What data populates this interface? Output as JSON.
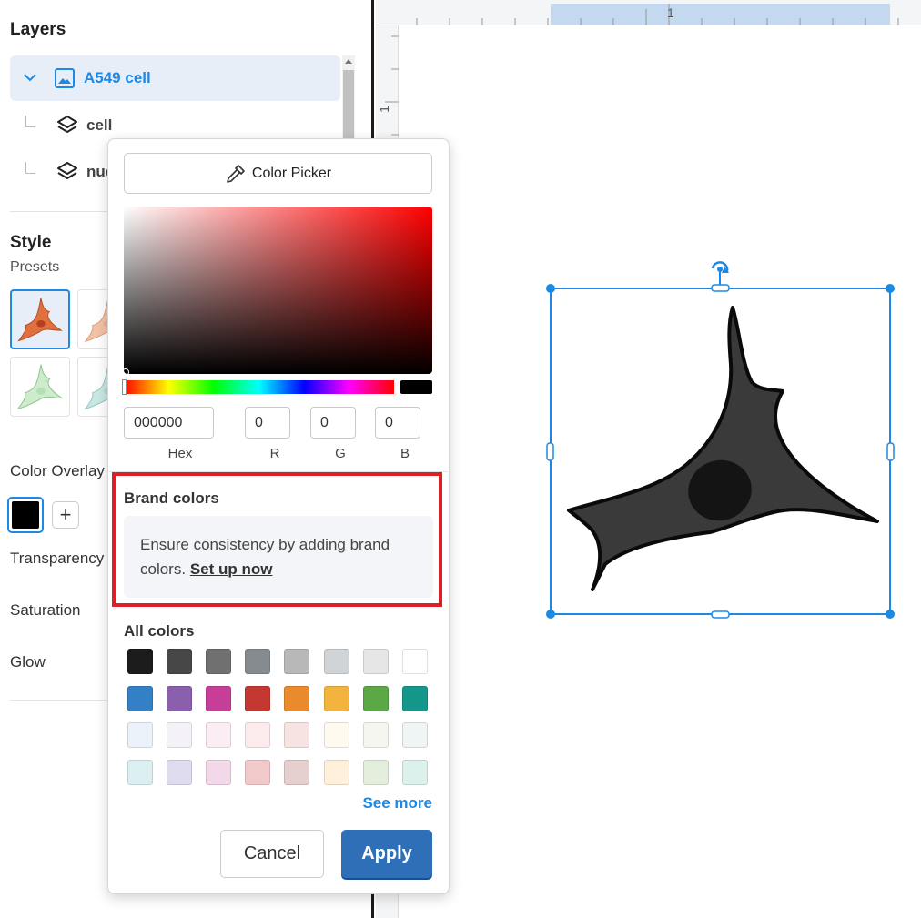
{
  "layers": {
    "title": "Layers",
    "items": [
      {
        "label": "A549 cell",
        "icon": "image-icon",
        "selected": true
      },
      {
        "label": "cell",
        "icon": "layers-icon"
      },
      {
        "label": "nuc",
        "icon": "layers-icon"
      }
    ]
  },
  "style": {
    "title": "Style",
    "presets_label": "Presets",
    "presets": [
      {
        "color": "#e0703e",
        "selected": true
      },
      {
        "color": "#f3c2a6"
      },
      {
        "color": "#cdeccb"
      },
      {
        "color": "#c9e7e4"
      }
    ],
    "color_overlay_label": "Color Overlay",
    "overlay_color": "#000000",
    "add_label": "+",
    "transparency_label": "Transparency",
    "saturation_label": "Saturation",
    "glow_label": "Glow"
  },
  "ruler": {
    "top_number": "1",
    "left_number": "1"
  },
  "color_picker": {
    "picker_button_label": "Color Picker",
    "hex_value": "000000",
    "r_value": "0",
    "g_value": "0",
    "b_value": "0",
    "hex_label": "Hex",
    "r_label": "R",
    "g_label": "G",
    "b_label": "B",
    "brand_title": "Brand colors",
    "brand_note": "Ensure consistency by adding brand colors.",
    "brand_link": "Set up now",
    "all_colors_title": "All colors",
    "colors": [
      [
        "#1c1c1c",
        "#474747",
        "#707070",
        "#858b8f",
        "#b8b8b8",
        "#d1d4d6",
        "#e6e6e6",
        "#ffffff"
      ],
      [
        "#3480c4",
        "#8a5fad",
        "#c63e98",
        "#c53731",
        "#e98a2c",
        "#f2b33f",
        "#5ba846",
        "#15968b"
      ],
      [
        "#ecf2fa",
        "#f5f1f8",
        "#fcedf5",
        "#fcebec",
        "#f7e3e1",
        "#fffaf0",
        "#f4f6ef",
        "#eef5f4"
      ],
      [
        "#dcf0f2",
        "#e0dcf0",
        "#f2d8e8",
        "#f2c9cb",
        "#e6cfcf",
        "#fff0dc",
        "#e4eedc",
        "#dcf0ec"
      ]
    ],
    "see_more": "See more",
    "cancel_label": "Cancel",
    "apply_label": "Apply"
  },
  "colors": {
    "accent": "#1e88e5",
    "highlight_border": "#dd1f26",
    "apply_bg": "#2f6fb8"
  }
}
